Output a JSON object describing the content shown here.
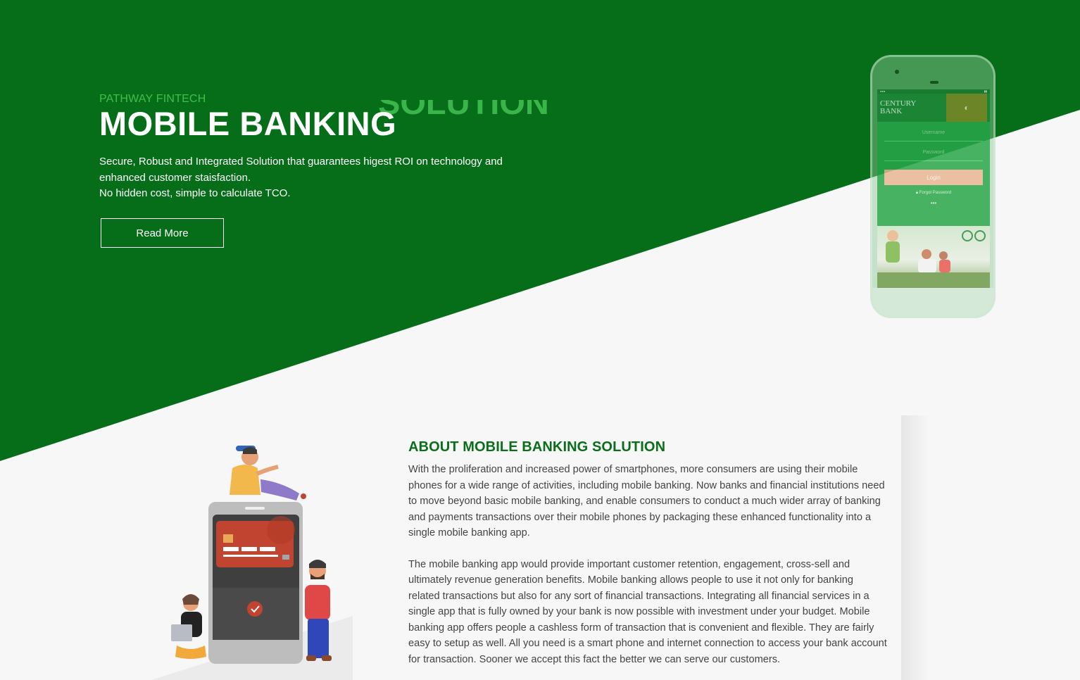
{
  "colors": {
    "hero_green": "#066e19",
    "accent_green": "#3fbf4a",
    "heading_green": "#0a6e1a",
    "background": "#f7f7f7"
  },
  "hero": {
    "eyebrow": "PATHWAY FINTECH",
    "title": "MOBILE BANKING",
    "title_ghost": "SOLUTION",
    "desc_line1": "Secure, Robust and Integrated Solution that guarantees higest ROI on technology and enhanced customer staisfaction.",
    "desc_line2": "No hidden cost, simple to calculate TCO.",
    "read_more_label": "Read More"
  },
  "phone_mockup": {
    "bank_name_line1": "CENTURY",
    "bank_name_line2": "BANK",
    "username_placeholder": "Username",
    "password_placeholder": "Password",
    "login_label": "Login",
    "forgot_label": "Forgot Password"
  },
  "about": {
    "title": "ABOUT MOBILE BANKING SOLUTION",
    "paragraph1": "With the proliferation and increased power of smartphones, more consumers are using their mobile phones for a wide range of activities, including mobile banking. Now banks and financial institutions need to move beyond basic mobile banking, and enable consumers to conduct a much wider array of banking and payments transactions over their mobile phones by packaging these enhanced functionality into a single mobile banking app.",
    "paragraph2": "The mobile banking app would provide important customer retention, engagement, cross-sell and ultimately revenue generation benefits. Mobile banking allows people to use it not only for banking related transactions but also for any sort of financial transactions. Integrating all financial services in a single app that is fully owned by your bank is now possible with investment under your budget. Mobile banking app offers people a cashless form of transaction that is convenient and flexible. They are fairly easy to setup as well. All you need is a smart phone and internet connection to access your bank account for transaction. Sooner we accept this fact the better we can serve our customers."
  }
}
